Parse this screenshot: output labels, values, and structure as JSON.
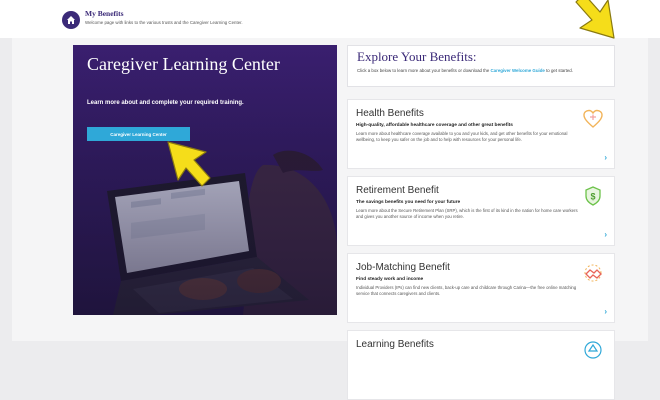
{
  "header": {
    "title": "My Benefits",
    "subtitle": "Welcome page with links to the various trusts and the Caregiver Learning Center."
  },
  "hero": {
    "title": "Caregiver Learning Center",
    "subtitle": "Learn more about and complete your required training.",
    "button_label": "Caregiver Learning Center"
  },
  "explore": {
    "title": "Explore Your Benefits:",
    "desc_prefix": "Click a box below to learn more about your benefits or download the ",
    "desc_link": "Caregiver Welcome Guide",
    "desc_suffix": " to get started."
  },
  "cards": [
    {
      "title": "Health Benefits",
      "tagline": "High-quality, affordable healthcare coverage and other great benefits",
      "desc": "Learn more about healthcare coverage available to you and your kids, and get other benefits for your emotional wellbeing, to keep you safer on the job and to help with resources for your personal life.",
      "icon": "heart-icon",
      "accent": "#f2b45a"
    },
    {
      "title": "Retirement Benefit",
      "tagline": "The savings benefits you need for your future",
      "desc": "Learn more about the Secure Retirement Plan (SRP), which is the first of its kind in the nation for home care workers and gives you another source of income when you retire.",
      "icon": "shield-dollar-icon",
      "accent": "#6cc24a"
    },
    {
      "title": "Job-Matching Benefit",
      "tagline": "Find steady work and income",
      "desc": "Individual Providers (IPs) can find new clients, back-up care and childcare through Carina—the free online matching service that connects caregivers and clients.",
      "icon": "handshake-icon",
      "accent": "#e8645a"
    },
    {
      "title": "Learning Benefits",
      "tagline": "",
      "desc": "",
      "icon": "learning-icon",
      "accent": "#2fa8d8"
    }
  ],
  "colors": {
    "brand_purple": "#3b2a78",
    "accent_blue": "#2fa8d8",
    "cursor_yellow": "#f5dd1a"
  }
}
